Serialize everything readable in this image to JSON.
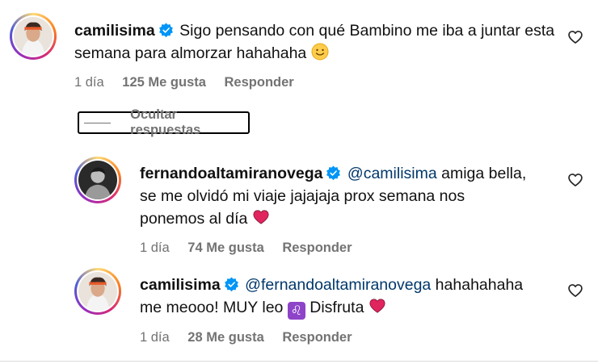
{
  "comments": [
    {
      "username": "camilisima",
      "text": "Sigo pensando con qué Bambino me iba a juntar esta semana para almorzar hahahaha",
      "emoji": "slightly-smiling-face",
      "time": "1 día",
      "likes": "125 Me gusta",
      "reply_label": "Responder"
    }
  ],
  "hide_replies_label": "Ocultar respuestas",
  "replies": [
    {
      "username": "fernandoaltamiranovega",
      "mention": "@camilisima",
      "text_line1": " amiga bella,",
      "text_line2": "se me olvidó mi viaje jajajaja prox semana nos",
      "text_line3": "ponemos al día",
      "emoji": "red-heart",
      "time": "1 día",
      "likes": "74 Me gusta",
      "reply_label": "Responder"
    },
    {
      "username": "camilisima",
      "mention": "@fernandoaltamiranovega",
      "text_line1": " hahahahaha",
      "text_line2": "me meooo! MUY leo",
      "sign": "♌",
      "text_after_sign": "Disfruta",
      "emoji": "red-heart",
      "time": "1 día",
      "likes": "28 Me gusta",
      "reply_label": "Responder"
    }
  ],
  "colors": {
    "mention": "#00376b",
    "meta": "#737373",
    "verified": "#0095f6",
    "heart": "#e0245e"
  },
  "icons": [
    "verified-badge-icon",
    "heart-outline-icon",
    "red-heart-emoji",
    "smile-emoji",
    "leo-sign-emoji"
  ]
}
